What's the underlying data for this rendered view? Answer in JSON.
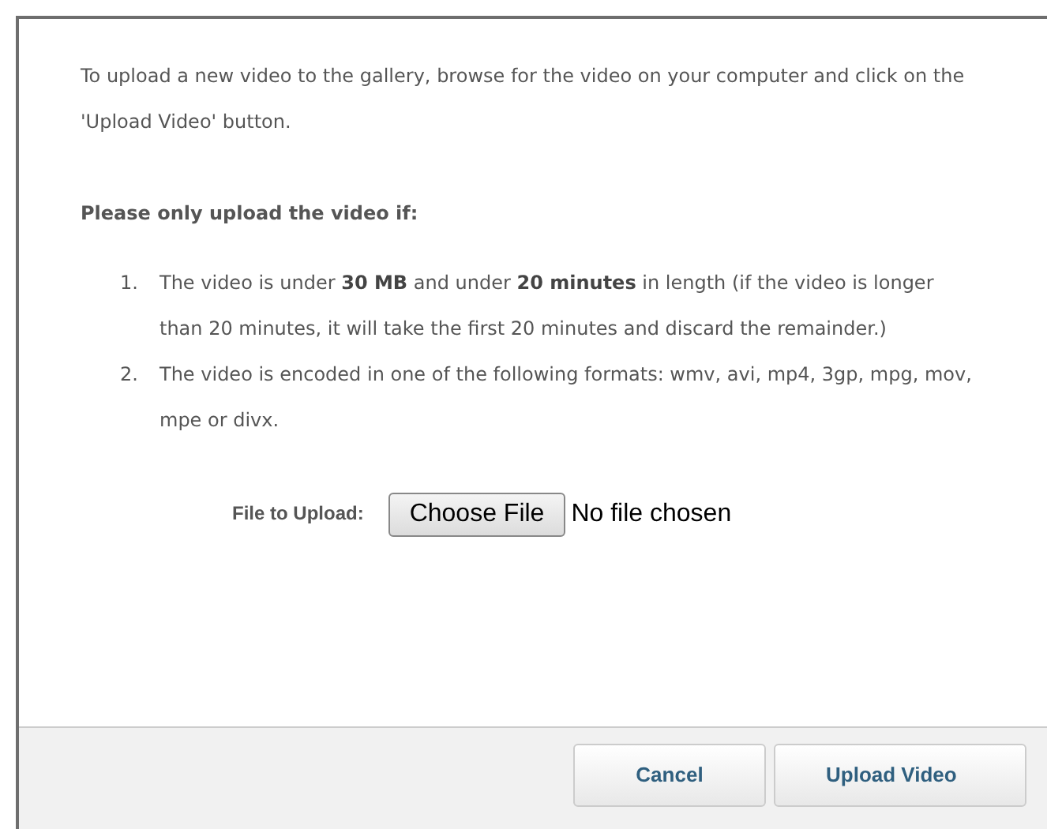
{
  "intro": "To upload a new video to the gallery, browse for the video on your computer and click on the 'Upload Video' button.",
  "conditions_heading": "Please only upload the video if:",
  "conditions": [
    {
      "number": "1.",
      "text": "The video is under **30 MB** and under **20 minutes** in length (if the video is longer than 20 minutes, it will take the first 20 minutes and discard the remainder.)"
    },
    {
      "number": "2.",
      "text": "The video is encoded in one of the following formats: wmv, avi, mp4, 3gp, mpg, mov, mpe or divx."
    }
  ],
  "file_field": {
    "label": "File to Upload:",
    "button": "Choose File",
    "status": "No file chosen"
  },
  "buttons": [
    "Cancel",
    "Upload Video"
  ]
}
